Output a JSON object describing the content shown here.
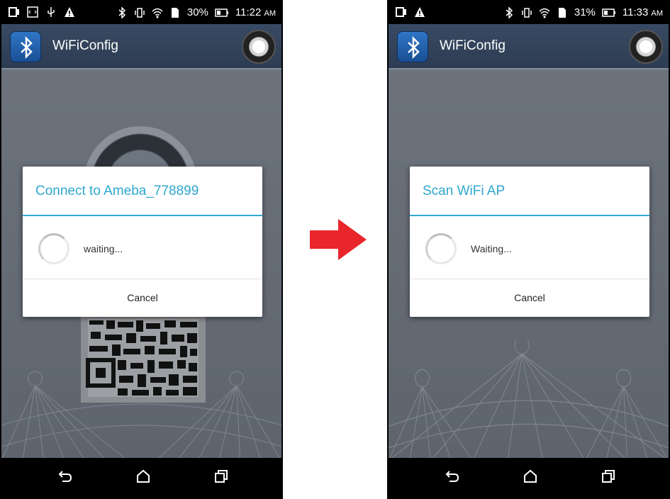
{
  "left": {
    "status": {
      "battery": "30%",
      "time": "11:22",
      "ampm": "AM"
    },
    "appbar": {
      "title": "WiFiConfig"
    },
    "dialog": {
      "title": "Connect to Ameba_778899",
      "message": "waiting...",
      "cancel": "Cancel"
    }
  },
  "right": {
    "status": {
      "battery": "31%",
      "time": "11:33",
      "ampm": "AM"
    },
    "appbar": {
      "title": "WiFiConfig"
    },
    "dialog": {
      "title": "Scan WiFi AP",
      "message": "Waiting...",
      "cancel": "Cancel"
    }
  },
  "colors": {
    "accent": "#35a9d3",
    "arrow": "#e8262b"
  },
  "icons": [
    "bluetooth-icon",
    "vibrate-icon",
    "wifi-icon",
    "battery-icon",
    "back-icon",
    "home-icon",
    "recents-icon",
    "warning-icon",
    "usb-icon"
  ]
}
